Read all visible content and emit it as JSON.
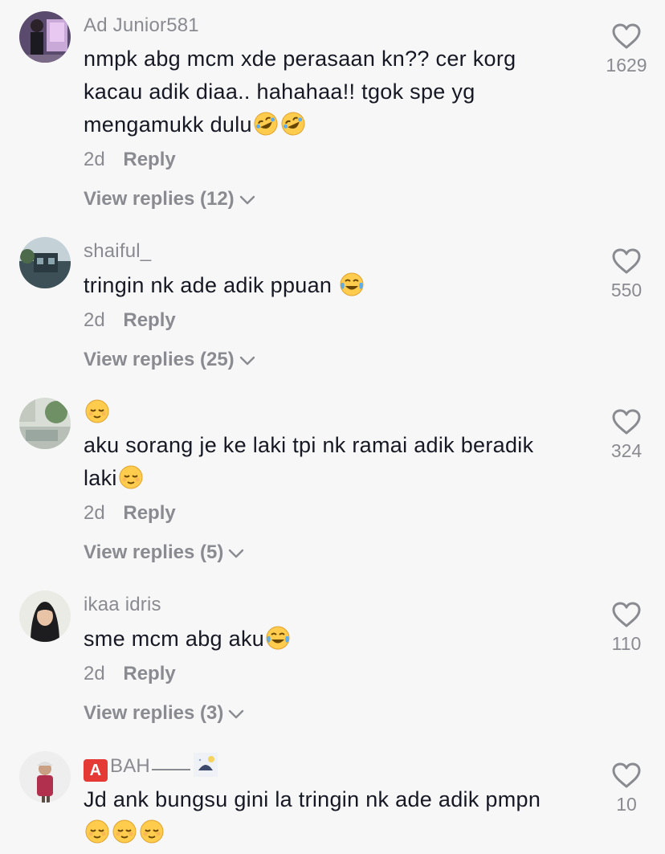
{
  "comments": [
    {
      "username": "Ad Junior581",
      "text_lines": [
        "nmpk abg mcm xde perasaan kn?? cer korg",
        "kacau adik diaa.. hahahaa!! tgok spe yg",
        "mengamukk dulu"
      ],
      "emoji_names": [
        "rofl-emoji",
        "rofl-emoji"
      ],
      "date": "2d",
      "reply_label": "Reply",
      "view_replies": "View replies (12)",
      "likes": "1629"
    },
    {
      "username": "shaiful_",
      "text_lines": [
        "tringin nk ade adik ppuan"
      ],
      "emoji_names": [
        "tears-of-joy-emoji"
      ],
      "date": "2d",
      "reply_label": "Reply",
      "view_replies": "View replies (25)",
      "likes": "550"
    },
    {
      "username": "",
      "username_emoji": "relieved-emoji",
      "text_lines": [
        "aku sorang je ke laki tpi nk ramai adik beradik",
        "laki"
      ],
      "emoji_names": [
        "relieved-emoji"
      ],
      "date": "2d",
      "reply_label": "Reply",
      "view_replies": "View replies (5)",
      "likes": "324"
    },
    {
      "username": "ikaa idris",
      "text_lines": [
        "sme mcm abg aku"
      ],
      "emoji_names": [
        "tears-of-joy-emoji"
      ],
      "date": "2d",
      "reply_label": "Reply",
      "view_replies": "View replies (3)",
      "likes": "110"
    },
    {
      "username_badge": "A",
      "username": "BAH",
      "username_icon": "moon-icon",
      "text_lines": [
        "Jd ank bungsu gini la tringin nk ade adik pmpn"
      ],
      "emoji_names": [
        "relieved-emoji",
        "relieved-emoji",
        "relieved-emoji"
      ],
      "likes": "10"
    }
  ],
  "colors": {
    "background": "#f7f7f8",
    "text": "#161823",
    "secondary": "#8a8b91",
    "badge": "#e53935"
  }
}
